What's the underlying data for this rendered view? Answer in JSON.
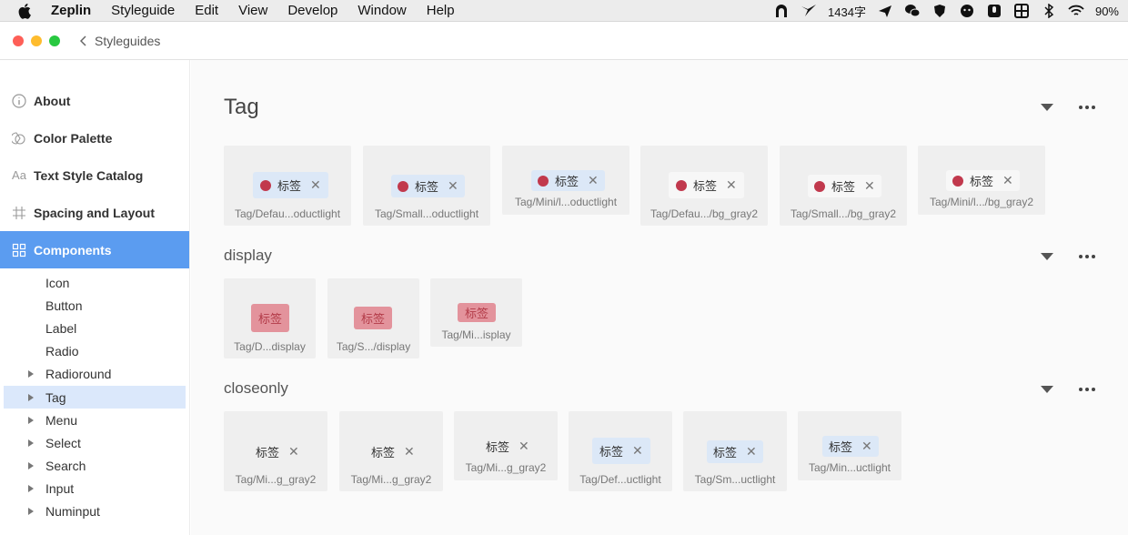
{
  "menubar": {
    "app_name": "Zeplin",
    "items": [
      "Styleguide",
      "Edit",
      "View",
      "Develop",
      "Window",
      "Help"
    ],
    "input_method_text": "1434字",
    "battery_text": "90%"
  },
  "window": {
    "back_label": "Styleguides"
  },
  "sidebar": {
    "items": [
      {
        "label": "About",
        "icon": "info-icon"
      },
      {
        "label": "Color Palette",
        "icon": "color-palette-icon"
      },
      {
        "label": "Text Style Catalog",
        "icon": "text-style-icon"
      },
      {
        "label": "Spacing and Layout",
        "icon": "spacing-icon"
      },
      {
        "label": "Components",
        "icon": "components-icon"
      }
    ],
    "components": [
      "Icon",
      "Button",
      "Label",
      "Radio",
      "Radioround",
      "Tag",
      "Menu",
      "Select",
      "Search",
      "Input",
      "Numinput"
    ],
    "text_style_icon_text": "Aa",
    "active_item": "Components",
    "selected_sub_item": "Tag"
  },
  "main": {
    "page_title": "Tag",
    "sections": [
      {
        "title": "display",
        "cards": [
          {
            "tag_label": "标签",
            "caption": "Tag/D...display"
          },
          {
            "tag_label": "标签",
            "caption": "Tag/S.../display"
          },
          {
            "tag_label": "标签",
            "caption": "Tag/Mi...isplay"
          }
        ]
      },
      {
        "title": "closeonly",
        "cards": [
          {
            "tag_label": "标签",
            "caption": "Tag/Mi...g_gray2"
          },
          {
            "tag_label": "标签",
            "caption": "Tag/Mi...g_gray2"
          },
          {
            "tag_label": "标签",
            "caption": "Tag/Mi...g_gray2"
          },
          {
            "tag_label": "标签",
            "caption": "Tag/Def...uctlight"
          },
          {
            "tag_label": "标签",
            "caption": "Tag/Sm...uctlight"
          },
          {
            "tag_label": "标签",
            "caption": "Tag/Min...uctlight"
          }
        ]
      }
    ],
    "tag_cards": [
      {
        "tag_label": "标签",
        "caption": "Tag/Defau...oductlight"
      },
      {
        "tag_label": "标签",
        "caption": "Tag/Small...oductlight"
      },
      {
        "tag_label": "标签",
        "caption": "Tag/Mini/l...oductlight"
      },
      {
        "tag_label": "标签",
        "caption": "Tag/Defau.../bg_gray2"
      },
      {
        "tag_label": "标签",
        "caption": "Tag/Small.../bg_gray2"
      },
      {
        "tag_label": "标签",
        "caption": "Tag/Mini/l.../bg_gray2"
      }
    ],
    "close_glyph": "✕"
  },
  "colors": {
    "accent": "#5b9cf0",
    "dot_red": "#c1394d",
    "display_tag_bg": "#e3939c",
    "productlight_bg": "#dce8f7"
  }
}
